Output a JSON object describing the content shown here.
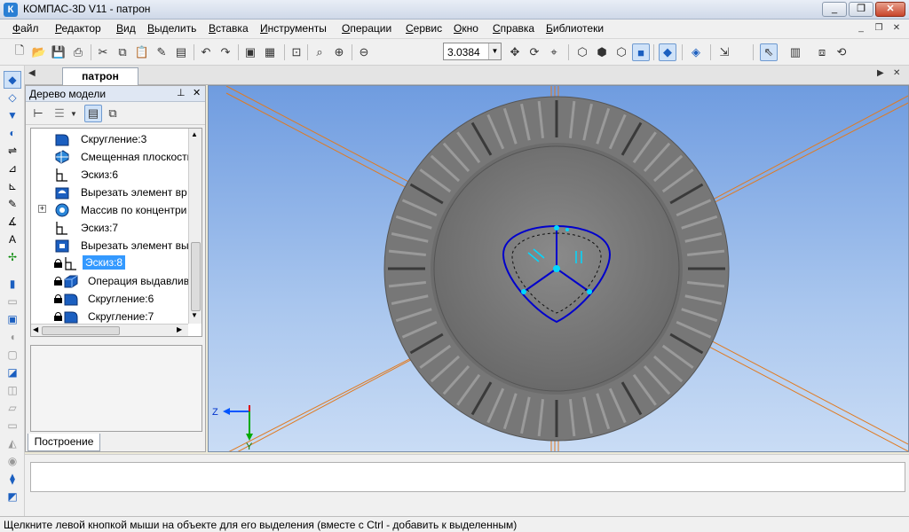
{
  "window": {
    "app_icon": "К",
    "title": "КОМПАС-3D V11 - патрон",
    "buttons": {
      "minimize": "_",
      "maximize": "❐",
      "close": "✕"
    }
  },
  "menu": {
    "items": [
      "Файл",
      "Редактор",
      "Вид",
      "Выделить",
      "Вставка",
      "Инструменты",
      "Операции",
      "Сервис",
      "Окно",
      "Справка",
      "Библиотеки"
    ],
    "mdi_buttons": [
      "_",
      "❐",
      "✕"
    ]
  },
  "toolbar": {
    "zoom_value": "3.0384",
    "icons": [
      "new-document-icon",
      "open-folder-icon",
      "save-icon",
      "print-icon",
      "cut-icon",
      "copy-icon",
      "paste-icon",
      "properties-icon",
      "library-icon",
      "undo-icon",
      "redo-icon",
      "manager-icon",
      "zoom-fit-icon",
      "zoom-window-icon",
      "zoom-in-icon",
      "zoom-out-icon",
      "pan-icon",
      "rotate-icon",
      "orientation-icon",
      "wireframe-icon",
      "hidden-lines-icon",
      "tangent-edges-icon",
      "shaded-icon",
      "shaded-edges-icon",
      "perspective-icon",
      "filter-icon",
      "select-icon",
      "library-manager-icon",
      "redraw-icon"
    ]
  },
  "document": {
    "tab_label": "патрон"
  },
  "tree": {
    "header": "Дерево модели",
    "items": [
      {
        "label": "Скругление:3",
        "icon": "fillet-icon",
        "locked": false,
        "selected": false
      },
      {
        "label": "Смещенная плоскость",
        "icon": "offset-plane-icon",
        "locked": false,
        "selected": false
      },
      {
        "label": "Эскиз:6",
        "icon": "sketch-icon",
        "locked": false,
        "selected": false
      },
      {
        "label": "Вырезать элемент вр",
        "icon": "cut-rotation-icon",
        "locked": false,
        "selected": false
      },
      {
        "label": "Массив по концентри",
        "icon": "circular-array-icon",
        "locked": false,
        "selected": false
      },
      {
        "label": "Эскиз:7",
        "icon": "sketch-icon",
        "locked": false,
        "selected": false
      },
      {
        "label": "Вырезать элемент вы",
        "icon": "cut-extrude-icon",
        "locked": false,
        "selected": false
      },
      {
        "label": "Эскиз:8",
        "icon": "sketch-icon",
        "locked": true,
        "selected": true
      },
      {
        "label": "Операция выдавлив",
        "icon": "extrude-icon",
        "locked": true,
        "selected": false
      },
      {
        "label": "Скругление:6",
        "icon": "fillet-icon",
        "locked": true,
        "selected": false
      },
      {
        "label": "Скругление:7",
        "icon": "fillet-icon",
        "locked": true,
        "selected": false
      }
    ],
    "bottom_tab": "Построение"
  },
  "viewport": {
    "axis_z_label": "Z",
    "axis_y_label": "Y",
    "colors": {
      "part": "#7d7d7d",
      "sketch": "#0000cc",
      "construction": "#e07a20",
      "background_top": "#6f9ce0",
      "background_bottom": "#c9dcf5"
    }
  },
  "status": {
    "text": "Щелкните левой кнопкой мыши на объекте для его выделения (вместе с Ctrl - добавить к выделенным)"
  }
}
